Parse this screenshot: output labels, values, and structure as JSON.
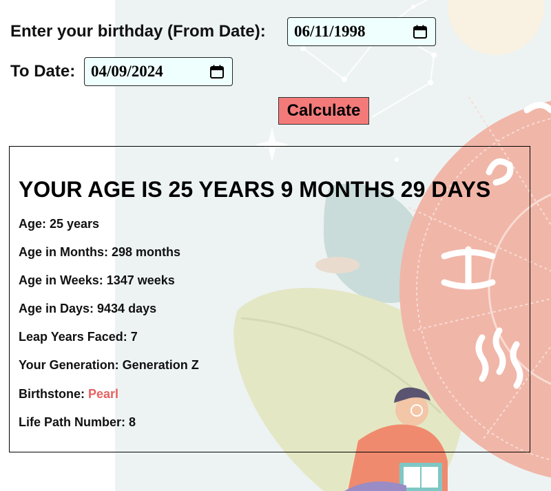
{
  "form": {
    "from_label": "Enter your birthday (From Date):",
    "from_value": "06/11/1998",
    "to_label": "To Date:",
    "to_value": "04/09/2024",
    "calculate_label": "Calculate"
  },
  "result": {
    "headline": "YOUR AGE IS 25 YEARS 9 MONTHS 29 DAYS",
    "lines": [
      "Age: 25 years",
      "Age in Months: 298 months",
      "Age in Weeks: 1347 weeks",
      "Age in Days: 9434 days",
      "Leap Years Faced: 7",
      "Your Generation: Generation Z"
    ],
    "birthstone_label": "Birthstone: ",
    "birthstone_value": "Pearl",
    "life_path": "Life Path Number: 8"
  },
  "colors": {
    "button": "#f47a7a",
    "input_bg": "#effffe",
    "birthstone": "#e86060",
    "zodiac_wheel": "#f0b6a8",
    "background_panel": "#edf3f3"
  },
  "icons": [
    "calendar-icon",
    "zodiac-wheel-illustration",
    "reading-person-illustration"
  ]
}
